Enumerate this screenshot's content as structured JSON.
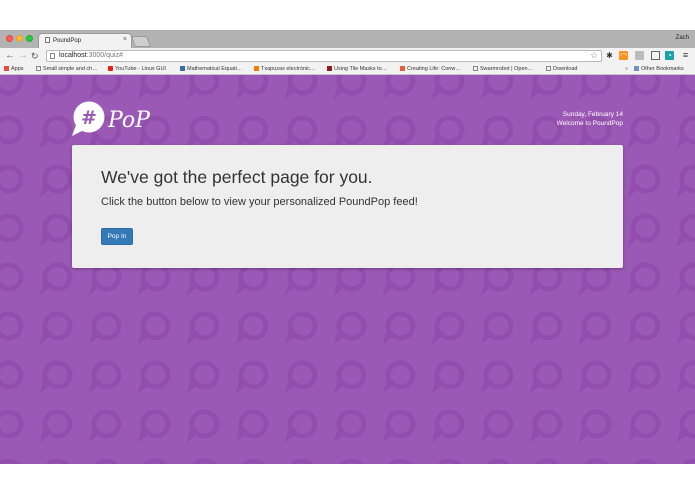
{
  "browser": {
    "tab_title": "PoundPop",
    "profile_name": "Zach",
    "url_host": "localhost",
    "url_path": ":3000/quiz#",
    "bookmarks": [
      {
        "label": "Apps",
        "icon": "apps-grid-icon",
        "color": "#e74c3c"
      },
      {
        "label": "Small simple and ch…",
        "icon": "page-icon",
        "color": "#888888"
      },
      {
        "label": "YouTube - Linux GUI",
        "icon": "youtube-icon",
        "color": "#e62117"
      },
      {
        "label": "Mathematical Equati…",
        "icon": "w3-icon",
        "color": "#3a6ea5"
      },
      {
        "label": "Txapuzas electrónic…",
        "icon": "blogger-icon",
        "color": "#f57d00"
      },
      {
        "label": "Using Tile Masks to…",
        "icon": "site-icon",
        "color": "#8e1c1c"
      },
      {
        "label": "Creating Life: Conw…",
        "icon": "site-icon",
        "color": "#e35d3b"
      },
      {
        "label": "Swarmrobot | Open…",
        "icon": "page-icon",
        "color": "#888888"
      },
      {
        "label": "Download",
        "icon": "page-icon",
        "color": "#888888"
      }
    ],
    "other_bookmarks": "Other Bookmarks"
  },
  "page": {
    "logo_hash": "#",
    "logo_text": "PoP",
    "date": "Sunday, February 14",
    "welcome": "Welcome to PoundPop",
    "headline": "We've got the perfect page for you.",
    "subtitle": "Click the button below to view your personalized PoundPop feed!",
    "button_label": "Pop In"
  },
  "colors": {
    "background": "#9b59b6",
    "pattern": "#8e4aa8",
    "card": "#eeeeee",
    "button": "#337ab7"
  }
}
